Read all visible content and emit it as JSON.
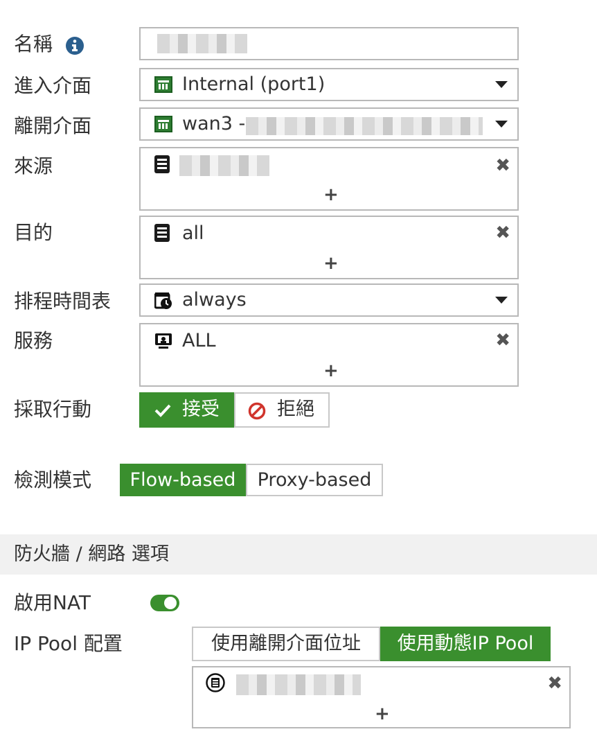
{
  "form": {
    "name_label": "名稱",
    "incoming_label": "進入介面",
    "incoming_value": "Internal (port1)",
    "outgoing_label": "離開介面",
    "outgoing_value": "wan3 -",
    "source_label": "來源",
    "dest_label": "目的",
    "dest_value": "all",
    "schedule_label": "排程時間表",
    "schedule_value": "always",
    "service_label": "服務",
    "service_value": "ALL",
    "action_label": "採取行動",
    "action_accept": "接受",
    "action_deny": "拒絕",
    "inspection_label": "檢測模式",
    "flow_based": "Flow-based",
    "proxy_based": "Proxy-based",
    "plus": "+",
    "remove": "✖"
  },
  "section": {
    "title": "防火牆 / 網路 選項"
  },
  "nat": {
    "label": "啟用NAT",
    "enabled": true,
    "ippool_label": "IP Pool 配置",
    "use_outgoing": "使用離開介面位址",
    "use_dynamic": "使用動態IP Pool"
  },
  "colors": {
    "accent_green": "#3a8f2e",
    "info_blue": "#2b5f8e",
    "deny_red": "#d0342c"
  },
  "icons": {
    "info": "info-icon",
    "interface": "interface-icon",
    "address": "address-icon",
    "schedule": "schedule-icon",
    "service": "service-icon",
    "check": "check-icon",
    "deny": "deny-icon",
    "pool": "ip-pool-icon"
  }
}
